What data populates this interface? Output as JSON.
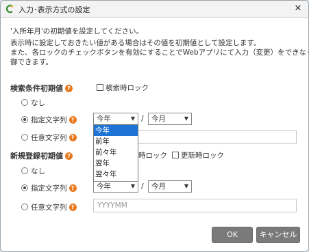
{
  "window": {
    "title": "入力･表示方式の設定",
    "close_glyph": "✕"
  },
  "description": {
    "line1": "'入所年月'の初期値を設定してください。",
    "line2": "表示時に設定しておきたい値がある場合はその値を初期値として設定します。",
    "line3": "また、各ロックのチェックボタンを有効にすることでWebアプリにて入力（変更）をできなくなるように制",
    "line4": "御できます。"
  },
  "search_section": {
    "title": "検索条件初期値",
    "lock_label": "検索時ロック",
    "options": {
      "none": "なし",
      "specified": "指定文字列",
      "arbitrary": "任意文字列"
    },
    "year_select": "今年",
    "month_select": "今月"
  },
  "dropdown": {
    "items": [
      "今年",
      "前年",
      "前々年",
      "翌年",
      "翌々年"
    ],
    "selected_index": 0
  },
  "new_section": {
    "title": "新規登録初期値",
    "lock_label_partial": "時ロック",
    "update_lock_label": "更新時ロック",
    "options": {
      "none": "なし",
      "specified": "指定文字列",
      "arbitrary": "任意文字列"
    },
    "year_select": "今年",
    "month_select": "今月",
    "arbitrary_placeholder": "YYYYMM"
  },
  "footer": {
    "ok_label": "OK",
    "cancel_label": "キャンセル"
  },
  "colors": {
    "accent": "#1e73d6",
    "help": "#e8791d",
    "button": "#7a7a7a"
  }
}
